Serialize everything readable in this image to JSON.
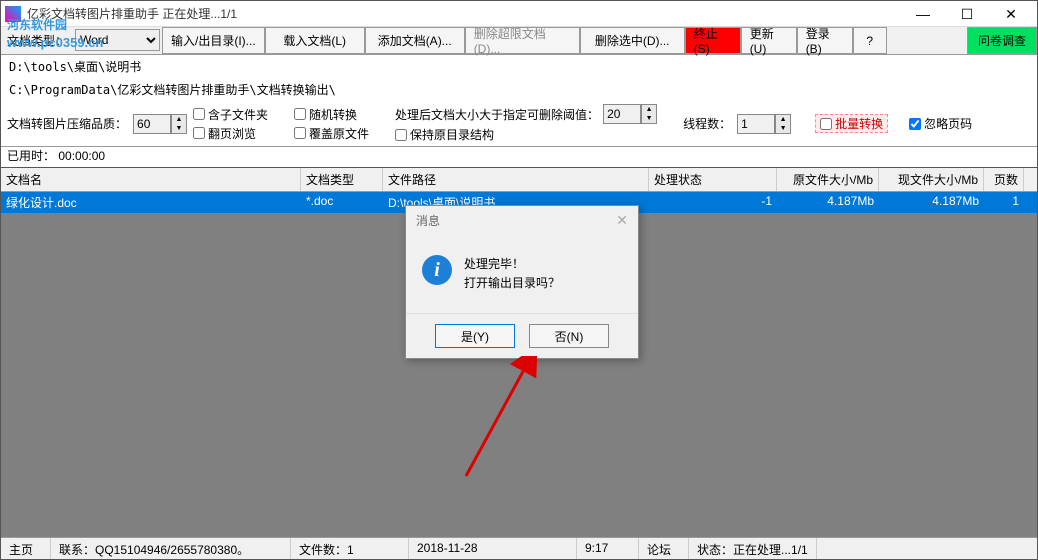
{
  "title": "亿彩文档转图片排重助手 正在处理...1/1",
  "watermark": {
    "name": "河东软件园",
    "url": "www.pc0359.cn"
  },
  "window_controls": {
    "min": "—",
    "max": "☐",
    "close": "✕"
  },
  "toolbar": {
    "type_label": "文档类型：",
    "type_value": "Word",
    "btns": {
      "io_dir": "输入/出目录(I)...",
      "load": "载入文档(L)",
      "add": "添加文档(A)...",
      "del_over": "删除超限文档(D)...",
      "del_sel": "删除选中(D)...",
      "stop": "终止(S)",
      "update": "更新(U)",
      "login": "登录(B)",
      "help": "?",
      "survey": "问卷调查"
    }
  },
  "paths": {
    "input": "D:\\tools\\桌面\\说明书",
    "output": "C:\\ProgramData\\亿彩文档转图片排重助手\\文档转换输出\\"
  },
  "opts": {
    "quality_label": "文档转图片压缩品质：",
    "quality_value": "60",
    "include_sub": "含子文件夹",
    "flip_preview": "翻页浏览",
    "random_convert": "随机转换",
    "overwrite": "覆盖原文件",
    "delete_threshold_label": "处理后文档大小大于指定可删除阈值：",
    "delete_threshold_value": "20",
    "threads_label": "线程数：",
    "threads_value": "1",
    "batch": "批量转换",
    "ignore_pages": "忽略页码",
    "elapsed_label": "已用时：",
    "elapsed_value": "00:00:00",
    "keep_dir": "保持原目录结构"
  },
  "table": {
    "headers": {
      "name": "文档名",
      "type": "文档类型",
      "path": "文件路径",
      "status": "处理状态",
      "osize": "原文件大小/Mb",
      "nsize": "现文件大小/Mb",
      "pages": "页数"
    },
    "rows": [
      {
        "name": "绿化设计.doc",
        "type": "*.doc",
        "path": "D:\\tools\\桌面\\说明书",
        "status": "-1",
        "osize": "4.187Mb",
        "nsize": "4.187Mb",
        "pages": "1"
      }
    ]
  },
  "dialog": {
    "title": "消息",
    "msg1": "处理完毕！",
    "msg2": "打开输出目录吗？",
    "yes": "是(Y)",
    "no": "否(N)"
  },
  "status": {
    "home": "主页",
    "contact": "联系：QQ15104946/2655780380。",
    "files": "文件数：1",
    "date": "2018-11-28",
    "time": "9:17",
    "forum": "论坛",
    "state_label": "状态：",
    "state_value": "正在处理...1/1"
  }
}
